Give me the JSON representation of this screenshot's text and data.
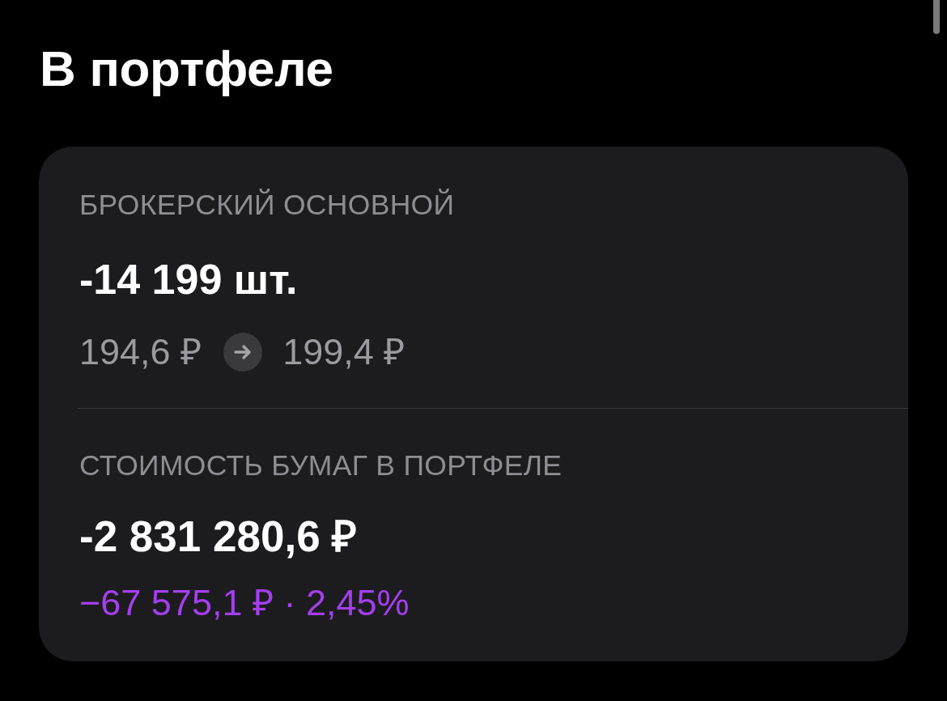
{
  "title": "В портфеле",
  "card": {
    "sections": [
      {
        "kind": "position",
        "label": "БРОКЕРСКИЙ ОСНОВНОЙ",
        "value": "-14 199 шт.",
        "price_from": "194,6 ₽",
        "price_to": "199,4 ₽"
      },
      {
        "kind": "worth",
        "label": "СТОИМОСТЬ БУМАГ В ПОРТФЕЛЕ",
        "value": "-2 831 280,6 ₽",
        "change": "−67 575,1 ₽ · 2,45%"
      }
    ]
  }
}
